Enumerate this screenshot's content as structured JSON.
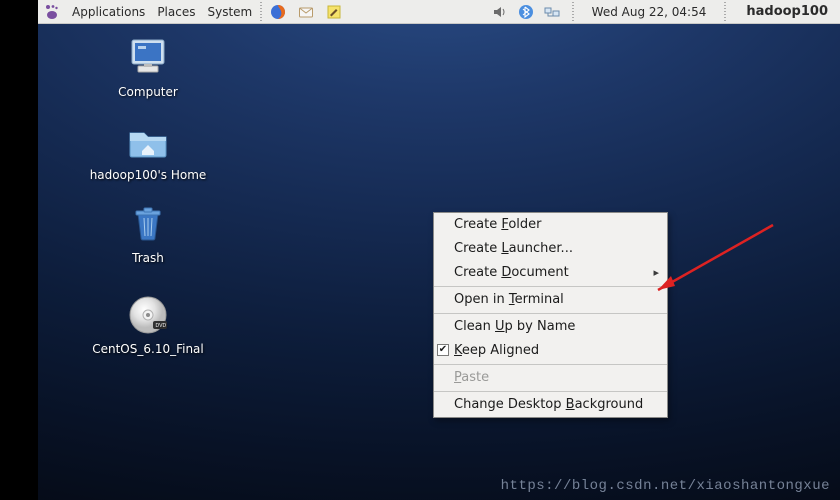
{
  "menubar": {
    "applications": "Applications",
    "places": "Places",
    "system": "System",
    "datetime": "Wed Aug 22, 04:54",
    "hostname": "hadoop100"
  },
  "desktop_icons": {
    "computer": "Computer",
    "home": "hadoop100's Home",
    "trash": "Trash",
    "cdrom": "CentOS_6.10_Final"
  },
  "context_menu": {
    "create_folder_pre": "Create ",
    "create_folder_ul": "F",
    "create_folder_post": "older",
    "create_launcher_pre": "Create ",
    "create_launcher_ul": "L",
    "create_launcher_post": "auncher...",
    "create_document_pre": "Create ",
    "create_document_ul": "D",
    "create_document_post": "ocument",
    "open_terminal_pre": "Open in ",
    "open_terminal_ul": "T",
    "open_terminal_post": "erminal",
    "cleanup_pre": "Clean ",
    "cleanup_ul": "U",
    "cleanup_post": "p by Name",
    "keep_aligned_ul": "K",
    "keep_aligned_post": "eep Aligned",
    "keep_aligned_check": "✔",
    "paste_ul": "P",
    "paste_post": "aste",
    "cdb_pre": "Change Desktop ",
    "cdb_ul": "B",
    "cdb_post": "ackground"
  },
  "watermark": "https://blog.csdn.net/xiaoshantongxue"
}
